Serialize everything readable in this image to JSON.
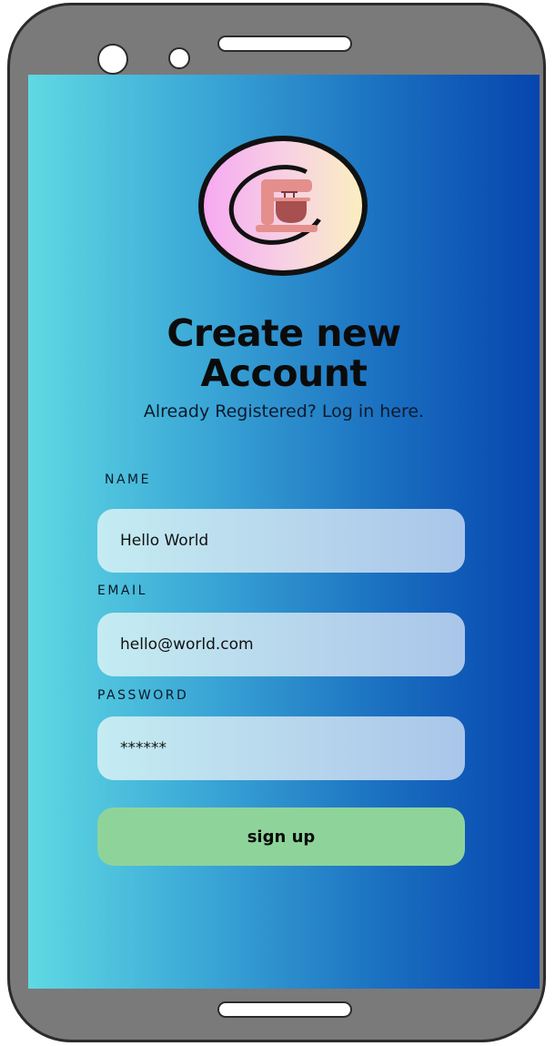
{
  "title": {
    "line1": "Create new",
    "line2": "Account"
  },
  "subtitle": "Already Registered? Log in here.",
  "form": {
    "name_label": "NAME",
    "name_value": "Hello World",
    "email_label": "EMAIL",
    "email_value": "hello@world.com",
    "password_label": "PASSWORD",
    "password_value": "******",
    "submit_label": "sign up"
  },
  "colors": {
    "screen_gradient_start": "#5fd9e3",
    "screen_gradient_end": "#0645ae",
    "button": "#8ed49a",
    "field": "#c4ecf2"
  },
  "icons": {
    "logo": "stand-mixer-icon"
  }
}
